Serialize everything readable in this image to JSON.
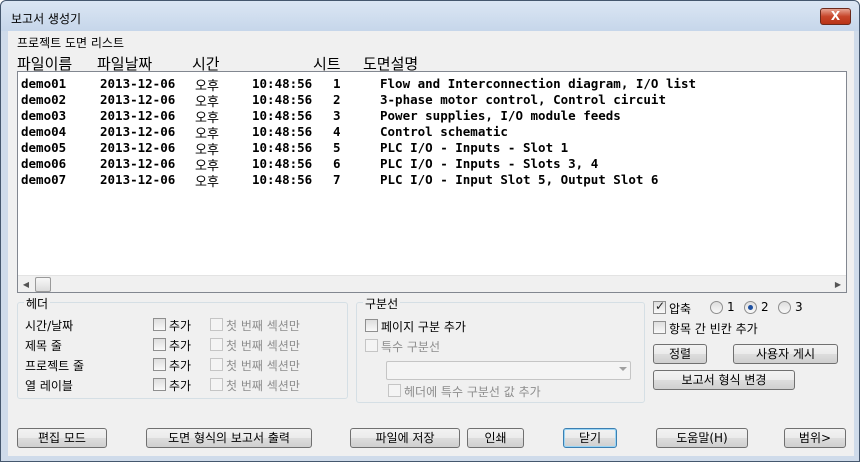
{
  "window": {
    "title": "보고서 생성기",
    "close_label": "X"
  },
  "list_caption": "프로젝트 도면 리스트",
  "columns": [
    "파일이름",
    "파일날짜",
    "시간",
    "시트",
    "도면설명"
  ],
  "rows": [
    {
      "file": "demo01",
      "date": "2013-12-06",
      "ampm": "오후",
      "time": "10:48:56",
      "sheet": "1",
      "desc": "Flow and Interconnection diagram, I/O list"
    },
    {
      "file": "demo02",
      "date": "2013-12-06",
      "ampm": "오후",
      "time": "10:48:56",
      "sheet": "2",
      "desc": "3-phase motor control, Control circuit"
    },
    {
      "file": "demo03",
      "date": "2013-12-06",
      "ampm": "오후",
      "time": "10:48:56",
      "sheet": "3",
      "desc": "Power supplies, I/O module feeds"
    },
    {
      "file": "demo04",
      "date": "2013-12-06",
      "ampm": "오후",
      "time": "10:48:56",
      "sheet": "4",
      "desc": "Control schematic"
    },
    {
      "file": "demo05",
      "date": "2013-12-06",
      "ampm": "오후",
      "time": "10:48:56",
      "sheet": "5",
      "desc": "PLC I/O - Inputs - Slot 1"
    },
    {
      "file": "demo06",
      "date": "2013-12-06",
      "ampm": "오후",
      "time": "10:48:56",
      "sheet": "6",
      "desc": "PLC I/O - Inputs - Slots 3, 4"
    },
    {
      "file": "demo07",
      "date": "2013-12-06",
      "ampm": "오후",
      "time": "10:48:56",
      "sheet": "7",
      "desc": "PLC I/O - Input Slot 5, Output Slot 6"
    }
  ],
  "header_group": {
    "title": "헤더",
    "rows": [
      {
        "label": "시간/날짜",
        "add": "추가",
        "first": "첫 번째 섹션만"
      },
      {
        "label": "제목 줄",
        "add": "추가",
        "first": "첫 번째 섹션만"
      },
      {
        "label": "프로젝트 줄",
        "add": "추가",
        "first": "첫 번째 섹션만"
      },
      {
        "label": "열 레이블",
        "add": "추가",
        "first": "첫 번째 섹션만"
      }
    ]
  },
  "separator_group": {
    "title": "구분선",
    "page_sep": "페이지 구분 추가",
    "special_sep": "특수 구분선",
    "header_special": "헤더에 특수 구분선 값 추가",
    "combo_value": ""
  },
  "compress": {
    "label": "압축",
    "checked": true,
    "options": [
      "1",
      "2",
      "3"
    ],
    "selected": "2"
  },
  "blank_between": {
    "label": "항목 간 빈칸 추가",
    "checked": false
  },
  "buttons": {
    "sort": "정렬",
    "user_post": "사용자 게시",
    "change_format": "보고서 형식 변경",
    "edit_mode": "편집 모드",
    "print_drawing": "도면 형식의 보고서 출력",
    "save_file": "파일에 저장",
    "print": "인쇄",
    "close": "닫기",
    "help": "도움말(H)",
    "range": "범위>"
  }
}
